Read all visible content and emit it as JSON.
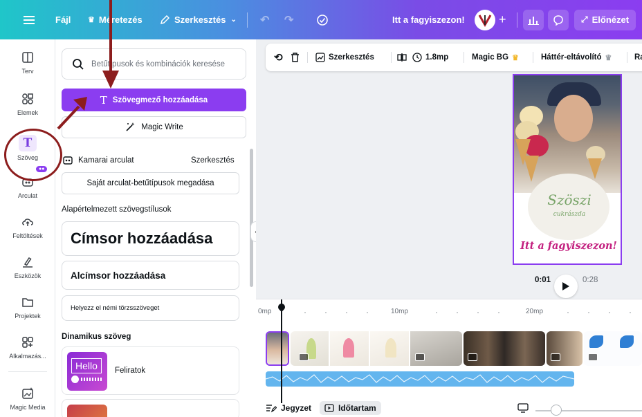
{
  "topbar": {
    "menu_icon": "hamburger-icon",
    "file_label": "Fájl",
    "resize_label": "Méretezés",
    "edit_label": "Szerkesztés",
    "document_title": "Itt a fagyiszezon!",
    "preview_label": "Előnézet"
  },
  "rail": {
    "items": [
      {
        "label": "Terv",
        "icon": "layout-icon"
      },
      {
        "label": "Elemek",
        "icon": "shapes-icon"
      },
      {
        "label": "Szöveg",
        "icon": "text-icon"
      },
      {
        "label": "Arculat",
        "icon": "brand-icon"
      },
      {
        "label": "Feltöltések",
        "icon": "upload-icon"
      },
      {
        "label": "Eszközök",
        "icon": "draw-icon"
      },
      {
        "label": "Projektek",
        "icon": "folder-icon"
      },
      {
        "label": "Alkalmazás...",
        "icon": "apps-icon"
      },
      {
        "label": "Magic Media",
        "icon": "magic-media-icon"
      }
    ]
  },
  "panel": {
    "search_placeholder": "Betűtípusok és kombinációk keresése",
    "add_textbox": "Szövegmező hozzáadása",
    "magic_write": "Magic Write",
    "brand_kit": "Kamarai arculat",
    "brand_edit": "Szerkesztés",
    "brand_fonts": "Saját arculat-betűtípusok megadása",
    "default_styles": "Alapértelmezett szövegstílusok",
    "heading": "Címsor hozzáadása",
    "subheading": "Alcímsor hozzáadása",
    "body_text": "Helyezz el némi törzsszöveget",
    "dynamic_text": "Dinamikus szöveg",
    "captions": "Feliratok",
    "hello_tile": "Hello"
  },
  "ctxbar": {
    "edit": "Szerkesztés",
    "duration": "1.8mp",
    "magic_bg": "Magic BG",
    "bg_remover": "Háttér-eltávolító",
    "more": "Ra"
  },
  "poster": {
    "logo": "Szöszi",
    "logo_sub": "cukrászda",
    "headline": "Itt a fagyiszezon!"
  },
  "player": {
    "current": "0:01",
    "total": "0:28"
  },
  "timeline": {
    "ruler": [
      "0mp",
      "10mp",
      "20mp"
    ],
    "notes": "Jegyzet",
    "duration": "Időtartam"
  },
  "colors": {
    "accent": "#8b3df0",
    "annotation": "#8c1d1d",
    "audio": "#63b5ee"
  }
}
